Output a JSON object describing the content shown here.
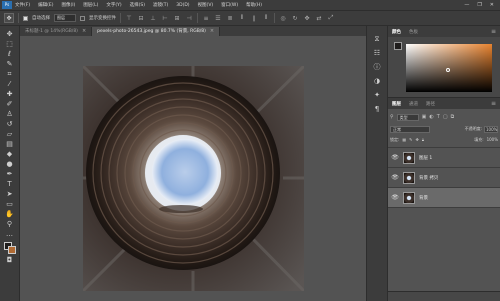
{
  "menubar": {
    "logo": "Ps",
    "items": [
      "文件(F)",
      "编辑(E)",
      "图像(I)",
      "图层(L)",
      "文字(Y)",
      "选择(S)",
      "滤镜(T)",
      "3D(D)",
      "视图(V)",
      "窗口(W)",
      "帮助(H)"
    ],
    "window_controls": [
      "—",
      "❐",
      "✕"
    ]
  },
  "options": {
    "auto_select_label": "自动选择",
    "auto_select_value": "图层",
    "show_transform_label": "显示变换控件"
  },
  "tabs": [
    {
      "label": "未标题-1 @ 14%(RGB/8)",
      "active": false
    },
    {
      "label": "pexels-photo-26543.jpeg @ 80.7% (背景, RGB/8)",
      "active": true
    }
  ],
  "color_panel": {
    "tabs": [
      "颜色",
      "色板"
    ],
    "colors": {
      "foreground": "#1f1d1c",
      "background": "#b06a33",
      "accent": "#e8832f"
    }
  },
  "layers_panel": {
    "tabs": [
      "图层",
      "通道",
      "路径"
    ],
    "filter_label": "类型",
    "blend_mode": "正常",
    "opacity_label": "不透明度:",
    "opacity_value": "100%",
    "lock_label": "锁定:",
    "fill_label": "填充:",
    "fill_value": "100%",
    "layers": [
      {
        "name": "图层 1",
        "visible": true,
        "selected": false
      },
      {
        "name": "背景 拷贝",
        "visible": true,
        "selected": false
      },
      {
        "name": "背景",
        "visible": true,
        "selected": true
      }
    ]
  }
}
